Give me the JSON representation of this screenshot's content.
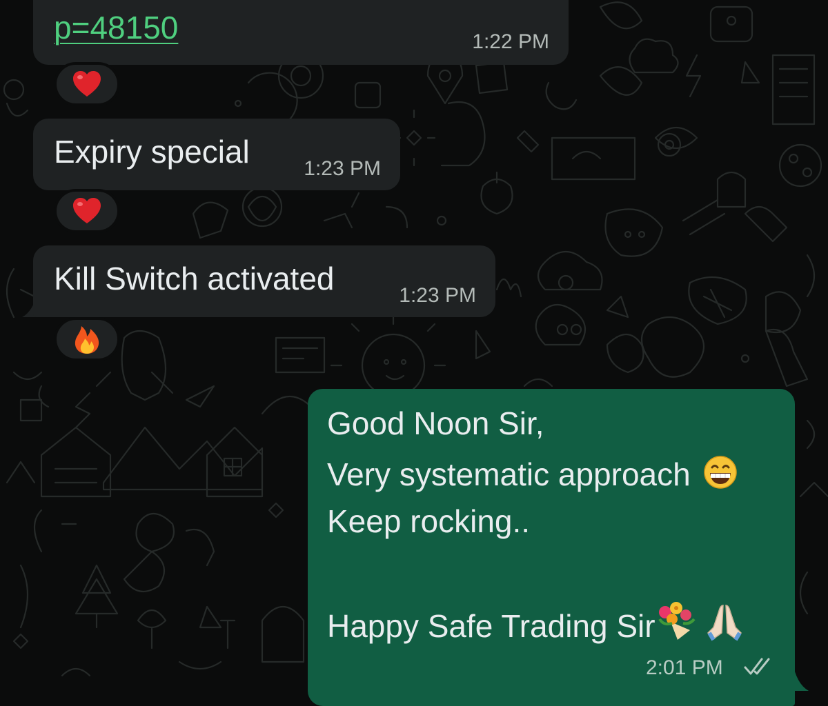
{
  "chat": {
    "messages": [
      {
        "direction": "incoming",
        "text": "p=48150",
        "is_link": true,
        "time": "1:22 PM",
        "reaction": "heart-icon"
      },
      {
        "direction": "incoming",
        "text": "Expiry special",
        "time": "1:23 PM",
        "reaction": "heart-icon"
      },
      {
        "direction": "incoming",
        "text": "Kill Switch activated",
        "time": "1:23 PM",
        "reaction": "fire-icon"
      },
      {
        "direction": "outgoing",
        "lines": [
          "Good Noon Sir,",
          "Very systematic approach",
          "Keep rocking..",
          "",
          "Happy Safe Trading Sir"
        ],
        "emojis": {
          "line2": "grinning-face-icon",
          "line5a": "bouquet-icon",
          "line5b": "folded-hands-icon"
        },
        "time": "2:01 PM",
        "status": "read-double-check-icon"
      }
    ]
  },
  "colors": {
    "background": "#0b0c0c",
    "incoming_bubble": "#1f2223",
    "outgoing_bubble": "#115e43",
    "link": "#4fcf7f",
    "text": "#e9edef"
  }
}
